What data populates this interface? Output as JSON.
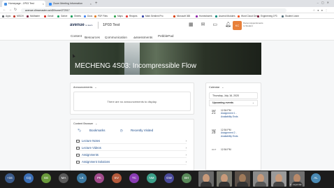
{
  "browser": {
    "tabs": [
      {
        "label": "Homepage - 1P03 Test",
        "active": true
      },
      {
        "label": "Zoom Meeting Information",
        "active": false
      }
    ],
    "new_tab": "+",
    "url": "avenue.cllmcmaster.ca/d2l/home/272017",
    "bookmarks": [
      "Apps",
      "MSCIV",
      "McMaster",
      "Gmail",
      "Gdrive",
      "Sheets",
      "Docs",
      "PDF Files",
      "Maps",
      "Recipes",
      "Mark Sentient Pro",
      "Microsoft 365",
      "Homeshwerk",
      "Ascend Modules",
      "Word Cloud Gen",
      "Engineering 1P3",
      "Student Learn"
    ]
  },
  "header": {
    "logo": "avenue",
    "logo_sub": "to learn",
    "course_title": "1P03 Test",
    "user_badge": "KC",
    "user_line1": "Person Appointments",
    "user_line2": "to Student"
  },
  "subnav": {
    "items": [
      "Content",
      "Resources",
      "Communication",
      "Assessments",
      "PebblePad"
    ]
  },
  "banner": {
    "title": "MECHENG 4S03: Incompressible Flow"
  },
  "announcements": {
    "header": "Announcements",
    "empty_text": "There are no announcements to display."
  },
  "content_browser": {
    "header": "Content Browser",
    "tabs": [
      "Bookmarks",
      "Recently Visited"
    ],
    "rows": [
      "Lecture Notes",
      "Lecture Videos",
      "Assignments",
      "Assignment Solutions"
    ]
  },
  "calendar": {
    "header": "Calendar",
    "date": "Thursday, July 16, 2020",
    "upcoming_header": "Upcoming events",
    "events": [
      {
        "month": "SEP",
        "day": "21",
        "time": "12:54 PM",
        "title": "Assignment 1 -",
        "subtitle": "Availability Ends"
      },
      {
        "month": "SEP",
        "day": "28",
        "time": "12:54 PM",
        "title": "Assignment 2 -",
        "subtitle": "Availability Ends"
      },
      {
        "month": "OCT",
        "day": "",
        "time": "12:54 PM",
        "title": "",
        "subtitle": ""
      }
    ]
  },
  "zoom": {
    "more_count": "+34",
    "participants": [
      {
        "initials": "CQ",
        "color": "#3b6eb4"
      },
      {
        "initials": "GE",
        "color": "#6a9a3c"
      },
      {
        "initials": "MA",
        "color": "#5a5a5a"
      },
      {
        "initials": "LK",
        "color": "#3c78a0"
      },
      {
        "initials": "PK",
        "color": "#a04a8a"
      },
      {
        "initials": "EV",
        "color": "#b45a3c"
      },
      {
        "initials": "TC",
        "color": "#8a3cb4"
      },
      {
        "initials": "NM",
        "color": "#3ca08a"
      },
      {
        "initials": "GW",
        "color": "#4a4a9a"
      },
      {
        "initials": "BH",
        "color": "#5a8a5a"
      },
      {
        "initials": "AL",
        "color": "#4a8ab4"
      }
    ],
    "video_label": "R. Lagendijk"
  }
}
